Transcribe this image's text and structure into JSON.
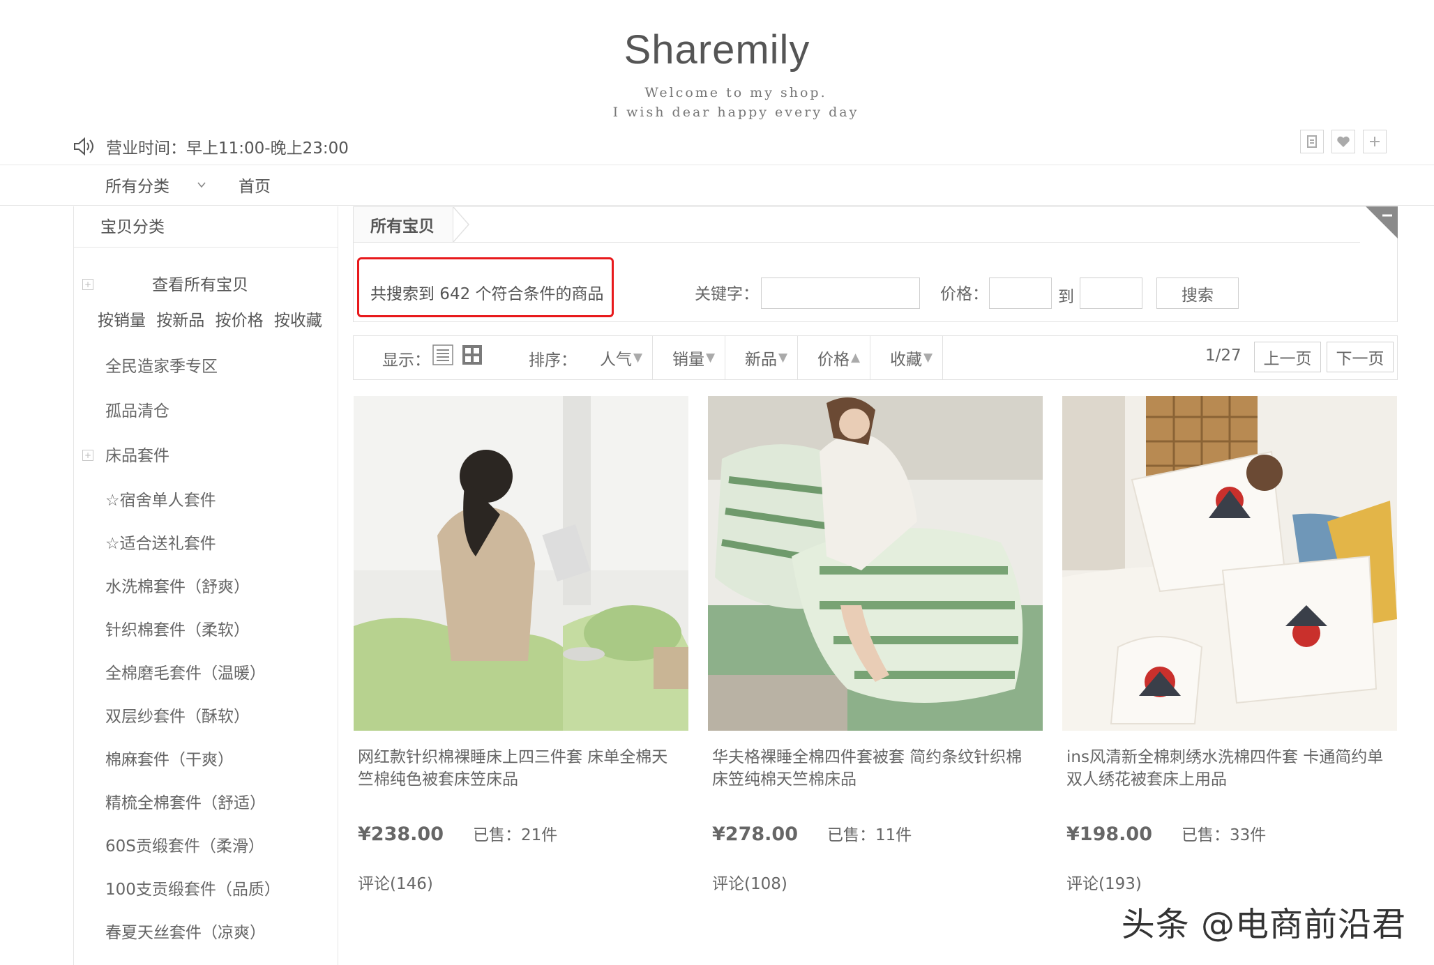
{
  "header": {
    "shop_name": "Sharemily",
    "tagline_1": "Welcome to my shop.",
    "tagline_2": "I wish dear happy every day",
    "hours": "营业时间：早上11:00-晚上23:00",
    "icons": [
      "document-icon",
      "heart-icon",
      "plus-icon"
    ]
  },
  "nav": {
    "categories_label": "所有分类",
    "home_label": "首页"
  },
  "sidebar": {
    "title": "宝贝分类",
    "view_all": "查看所有宝贝",
    "sort_links": "按销量 按新品 按价格 按收藏",
    "items": [
      "全民造家季专区",
      "孤品清仓",
      "床品套件",
      "☆宿舍单人套件",
      "☆适合送礼套件",
      "水洗棉套件（舒爽）",
      "针织棉套件（柔软）",
      "全棉磨毛套件（温暖）",
      "双层纱套件（酥软）",
      "棉麻套件（干爽）",
      "精梳全棉套件（舒适）",
      "60S贡缎套件（柔滑）",
      "100支贡缎套件（品质）",
      "春夏天丝套件（凉爽）"
    ]
  },
  "search": {
    "crumb": "所有宝贝",
    "result_text": "共搜索到 642 个符合条件的商品",
    "keyword_label": "关键字：",
    "keyword_value": "",
    "price_label": "价格：",
    "price_to": "到",
    "price_min": "",
    "price_max": "",
    "search_button": "搜索"
  },
  "toolbar": {
    "display_label": "显示：",
    "sort_label": "排序：",
    "sort_options": [
      {
        "label": "人气",
        "arrow": "down"
      },
      {
        "label": "销量",
        "arrow": "down"
      },
      {
        "label": "新品",
        "arrow": "down"
      },
      {
        "label": "价格",
        "arrow": "up"
      },
      {
        "label": "收藏",
        "arrow": "down"
      }
    ],
    "page_indicator": "1/27",
    "prev_label": "上一页",
    "next_label": "下一页"
  },
  "products": [
    {
      "title": "网红款针织棉裸睡床上四三件套 床单全棉天竺棉纯色被套床笠床品",
      "price": "¥238.00",
      "sold": "已售：21件",
      "reviews": "评论(146)"
    },
    {
      "title": "华夫格裸睡全棉四件套被套 简约条纹针织棉床笠纯棉天竺棉床品",
      "price": "¥278.00",
      "sold": "已售：11件",
      "reviews": "评论(108)"
    },
    {
      "title": "ins风清新全棉刺绣水洗棉四件套 卡通简约单双人绣花被套床上用品",
      "price": "¥198.00",
      "sold": "已售：33件",
      "reviews": "评论(193)"
    }
  ],
  "watermark": "头条 @电商前沿君",
  "colors": {
    "highlight_border": "#e8191c",
    "text": "#666666",
    "border": "#e2e2e2"
  }
}
